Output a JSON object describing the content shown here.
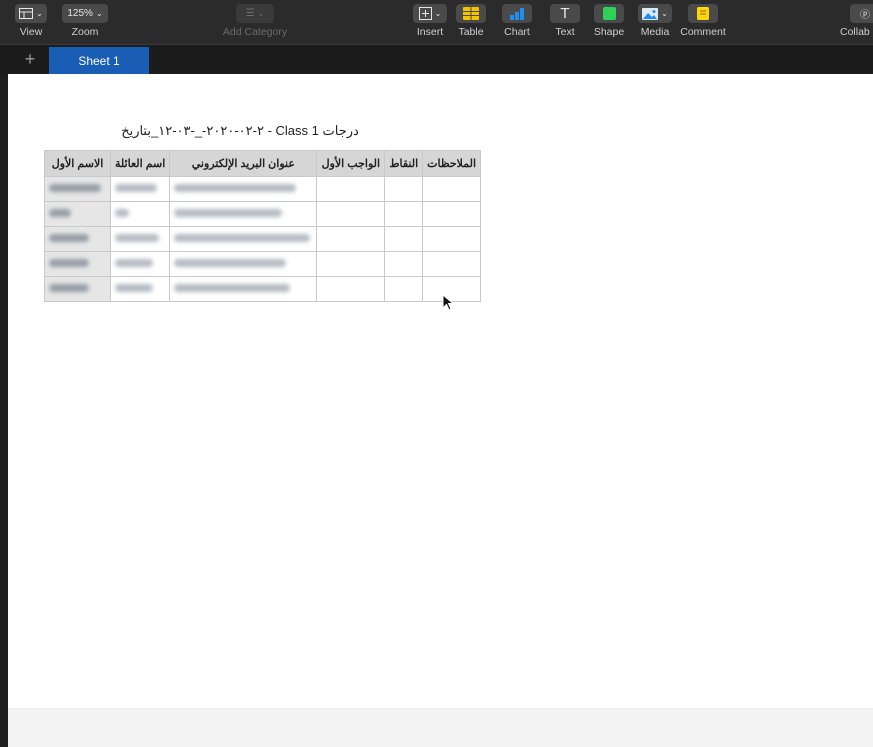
{
  "toolbar": {
    "view_label": "View",
    "zoom_value": "125%",
    "zoom_label": "Zoom",
    "add_category_label": "Add Category",
    "insert_label": "Insert",
    "table_label": "Table",
    "chart_label": "Chart",
    "text_label": "Text",
    "shape_label": "Shape",
    "media_label": "Media",
    "comment_label": "Comment",
    "collab_label": "Collab"
  },
  "tabs": {
    "active_sheet": "Sheet 1"
  },
  "table": {
    "title": "درجات Class 1 - ٢-٠٢-٢٠٢٠-_-٠٣-١٢_بتاريخ",
    "headers": [
      "الاسم الأول",
      "اسم العائلة",
      "عنوان البريد الإلكتروني",
      "الواجب الأول",
      "النقاط",
      "الملاحظات"
    ],
    "row_count": 5
  },
  "colors": {
    "accent": "#1a5db5",
    "table_yellow": "#f5c400",
    "chart_blue": "#1f8ef1",
    "shape_green": "#30d158",
    "comment_yellow": "#ffd60a"
  }
}
